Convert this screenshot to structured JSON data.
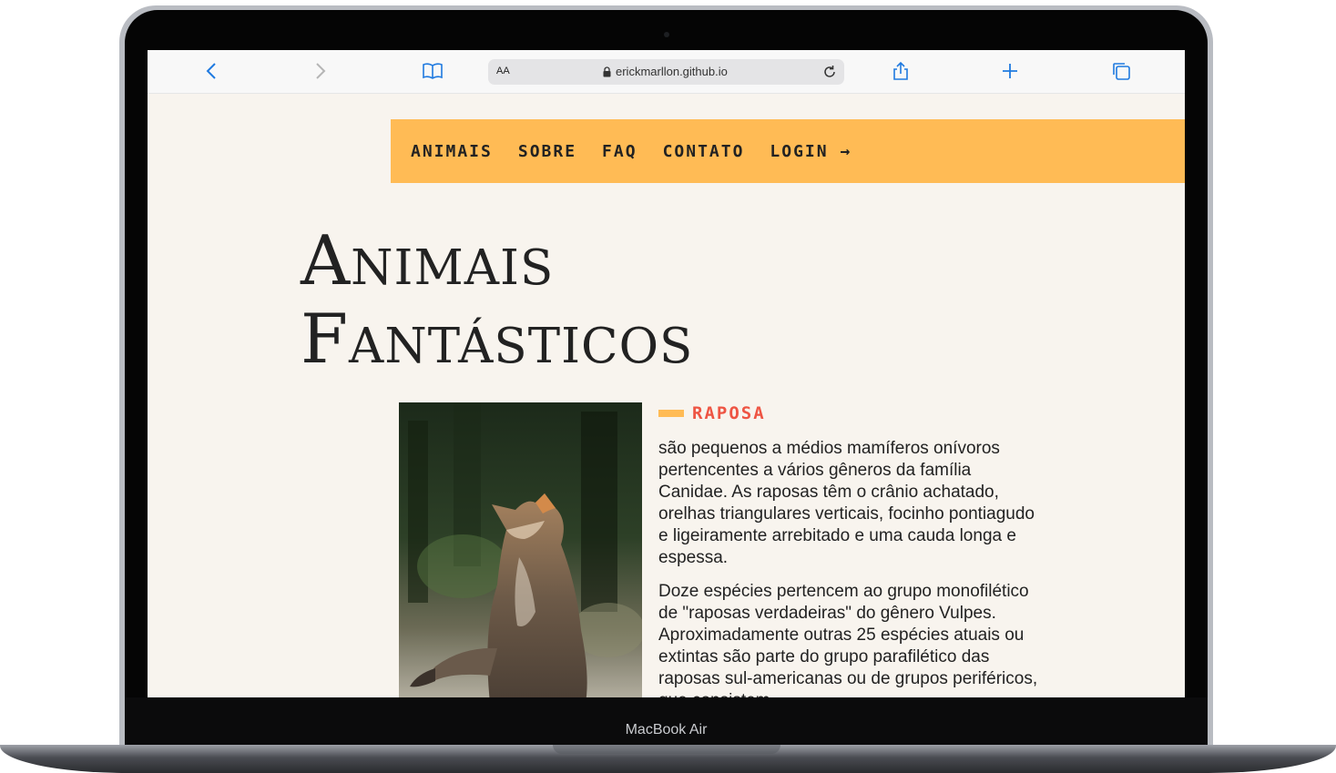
{
  "device": {
    "label": "MacBook Air"
  },
  "browser": {
    "text_size_label": "AA",
    "url": "erickmarllon.github.io"
  },
  "nav": {
    "items": [
      "ANIMAIS",
      "SOBRE",
      "FAQ",
      "CONTATO",
      "LOGIN →"
    ]
  },
  "hero": {
    "title_line1": "Animais",
    "title_line2": "Fantásticos"
  },
  "animal": {
    "name": "RAPOSA",
    "paragraph1": "são pequenos a médios mamíferos onívoros pertencentes a vários gêneros da família Canidae. As raposas têm o crânio achatado, orelhas triangulares verticais, focinho pontiagudo e ligeiramente arrebitado e uma cauda longa e espessa.",
    "paragraph2": "Doze espécies pertencem ao grupo monofilético de \"raposas verdadeiras\" do gênero Vulpes. Aproximadamente outras 25 espécies atuais ou extintas são parte do grupo parafilético das raposas sul-americanas ou de grupos periféricos, que consistem"
  },
  "colors": {
    "accent": "#ffbb55",
    "text": "#222222",
    "animal_name": "#ee5544",
    "page_background": "#f8f4ee"
  }
}
